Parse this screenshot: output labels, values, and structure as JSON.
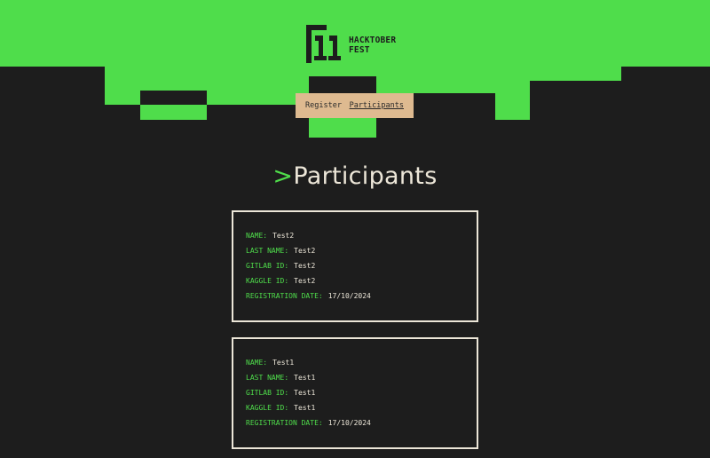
{
  "header": {
    "logo_line1": "HACKTOBER",
    "logo_line2": "FEST"
  },
  "nav": {
    "items": [
      {
        "label": "Register"
      },
      {
        "label": "Participants"
      }
    ]
  },
  "page": {
    "caret": ">",
    "title": "Participants"
  },
  "labels": {
    "name": "NAME:",
    "last_name": "LAST NAME:",
    "gitlab_id": "GITLAB ID:",
    "kaggle_id": "KAGGLE ID:",
    "registration_date": "REGISTRATION DATE:"
  },
  "participants": [
    {
      "name": "Test2",
      "last_name": "Test2",
      "gitlab_id": "Test2",
      "kaggle_id": "Test2",
      "registration_date": "17/10/2024"
    },
    {
      "name": "Test1",
      "last_name": "Test1",
      "gitlab_id": "Test1",
      "kaggle_id": "Test1",
      "registration_date": "17/10/2024"
    }
  ],
  "colors": {
    "accent": "#4fdd4b",
    "background": "#1d1d1d",
    "nav_background": "#deba90",
    "text": "#ece6d8"
  }
}
